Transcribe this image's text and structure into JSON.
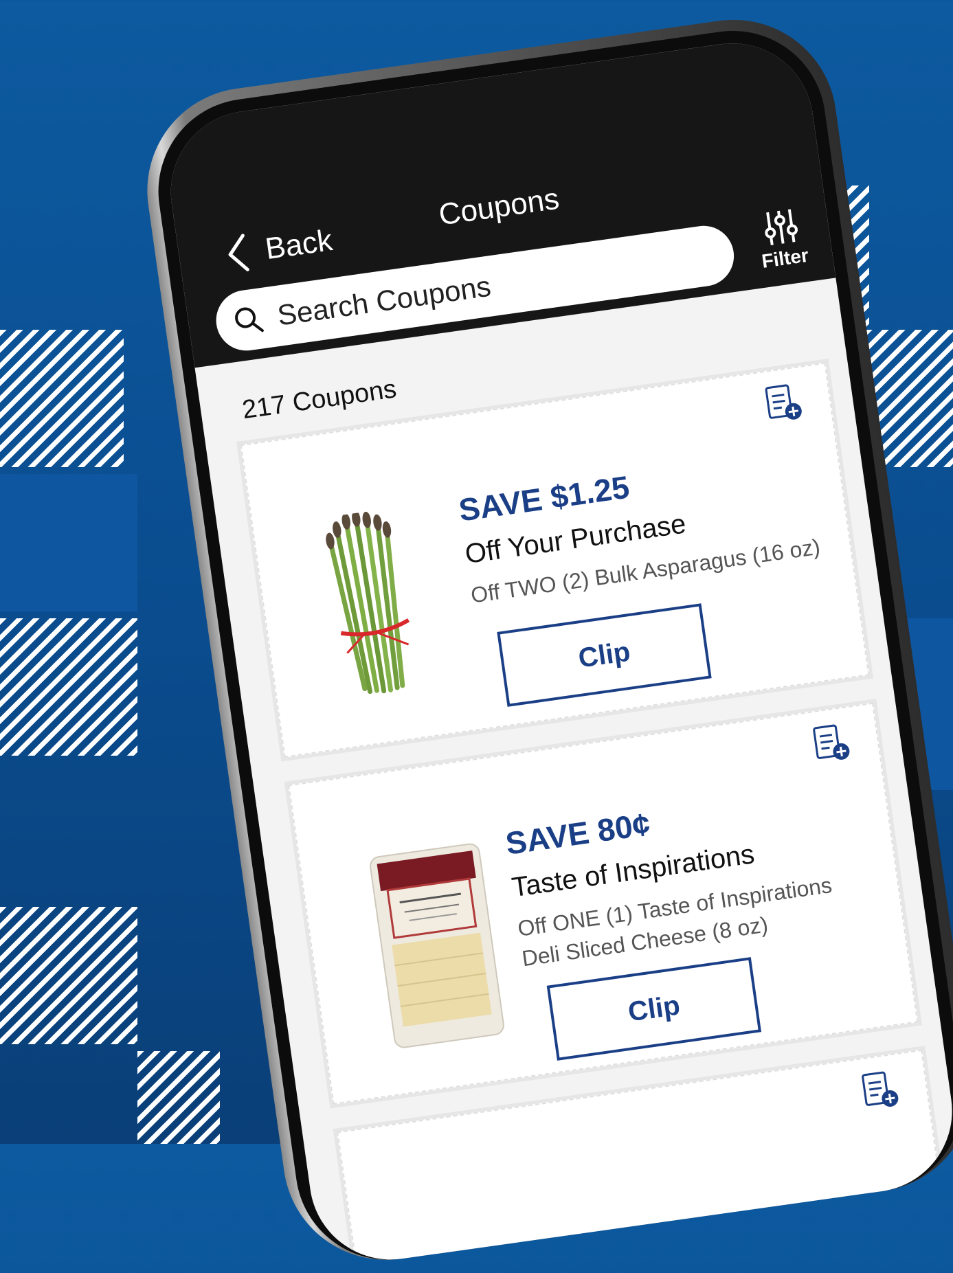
{
  "header": {
    "back_label": "Back",
    "title": "Coupons",
    "filter_label": "Filter",
    "search_placeholder": "Search Coupons"
  },
  "coupon_count": "217 Coupons",
  "coupons": [
    {
      "save": "SAVE $1.25",
      "headline": "Off Your Purchase",
      "description": "Off TWO (2) Bulk Asparagus (16 oz)",
      "clip_label": "Clip",
      "image": "asparagus"
    },
    {
      "save": "SAVE 80¢",
      "headline": "Taste of Inspirations",
      "description": "Off ONE (1) Taste of Inspirations Deli Sliced Cheese (8 oz)",
      "clip_label": "Clip",
      "image": "swiss-cheese-package"
    }
  ],
  "colors": {
    "background": "#0b4e92",
    "accent": "#1b3f86",
    "header": "#161616"
  }
}
